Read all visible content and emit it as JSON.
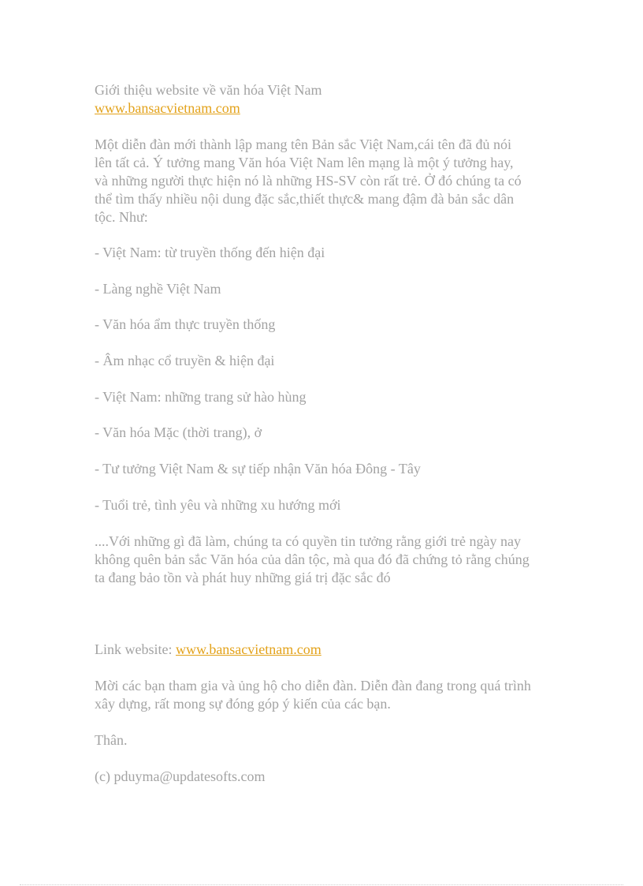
{
  "document": {
    "title": "Giới thiệu website về văn hóa Việt Nam",
    "title_link": "www.bansacvietnam.com",
    "intro": "Một diễn đàn mới thành lập mang tên Bản sắc Việt Nam,cái tên đã đủ nói lên tất cả. Ý tưởng mang Văn hóa Việt Nam lên mạng là một ý tưởng hay, và những người thực hiện nó là những HS-SV còn rất trẻ. Ở đó chúng ta có thể tìm thấy nhiều nội dung đặc sắc,thiết thực& mang đậm đà bản sắc dân tộc. Như:",
    "intro_lines": [
      "Một diễn đàn mới thành lập mang tên Bản sắc Việt Nam,cái tên đã đủ nói",
      "lên tất cả. Ý tưởng mang Văn hóa Việt Nam lên mạng là một ý tưởng hay,",
      "và những người thực hiện nó là những HS-SV còn rất trẻ. Ở đó chúng ta có",
      "thể tìm thấy nhiều nội dung đặc sắc,thiết thực& mang đậm đà bản sắc dân",
      "tộc. Như:"
    ],
    "list_items": [
      "- Việt Nam: từ truyền thống đến hiện đại",
      "- Làng nghề Việt Nam",
      "- Văn hóa ẩm thực truyền thống",
      "- Âm nhạc cổ truyền & hiện đại",
      "- Việt Nam: những trang sử hào hùng",
      "- Văn hóa Mặc (thời trang), ở",
      "- Tư tưởng Việt Nam & sự tiếp nhận Văn hóa Đông - Tây",
      "- Tuổi trẻ, tình yêu và những xu hướng mới"
    ],
    "closing_lines": [
      "....Với những gì đã làm, chúng ta có quyền tin tưởng rằng giới trẻ ngày nay",
      "không quên bản sắc Văn hóa của dân tộc, mà qua đó đã chứng tỏ rằng chúng",
      "ta đang bảo tồn và phát huy những giá trị đặc sắc đó"
    ],
    "link_label": "Link website: ",
    "link_url": "www.bansacvietnam.com",
    "invite_lines": [
      "Mời các bạn tham gia và ủng hộ cho diễn đàn. Diễn đàn đang trong quá trình",
      "xây dựng, rất mong sự đóng góp ý kiến của các bạn."
    ],
    "signoff": "Thân.",
    "copyright": "(c) pduyma@updatesofts.com"
  },
  "colors": {
    "text": "#a3a3a3",
    "link": "#e3a21a"
  }
}
